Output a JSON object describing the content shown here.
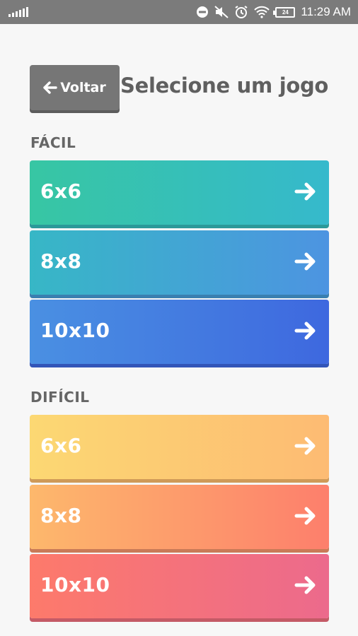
{
  "status_bar": {
    "time": "11:29 AM",
    "battery": "24",
    "icons": [
      "signal-icon",
      "dnd-icon",
      "mute-icon",
      "alarm-icon",
      "wifi-icon",
      "battery-icon"
    ]
  },
  "header": {
    "back_label": "Voltar",
    "title": "Selecione um jogo"
  },
  "sections": {
    "easy": {
      "label": "FÁCIL",
      "buttons": [
        "6x6",
        "8x8",
        "10x10"
      ]
    },
    "hard": {
      "label": "DIFÍCIL",
      "buttons": [
        "6x6",
        "8x8",
        "10x10"
      ]
    }
  },
  "colors": {
    "background": "#f7f7f7",
    "back_button": "#767676",
    "easy_gradient": [
      "#37c6a3",
      "#3e68df"
    ],
    "hard_gradient": [
      "#fcd873",
      "#ec6a8c"
    ]
  }
}
